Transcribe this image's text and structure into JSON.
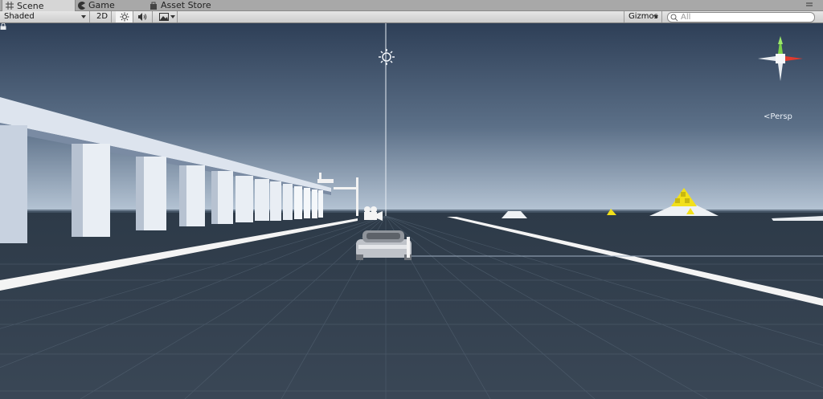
{
  "tabs": [
    {
      "label": "Scene",
      "icon": "grid-icon",
      "active": true
    },
    {
      "label": "Game",
      "icon": "pacman-icon",
      "active": false
    },
    {
      "label": "Asset Store",
      "icon": "bag-icon",
      "active": false
    }
  ],
  "toolbar": {
    "shading_mode": "Shaded",
    "mode_2d": "2D",
    "gizmos_label": "Gizmos",
    "search_value": "All"
  },
  "viewport": {
    "projection_label": "Persp",
    "sky_top_color": "#2e3f57",
    "sky_horizon_color": "#b7c6d6",
    "ground_color": "#3a4756"
  }
}
